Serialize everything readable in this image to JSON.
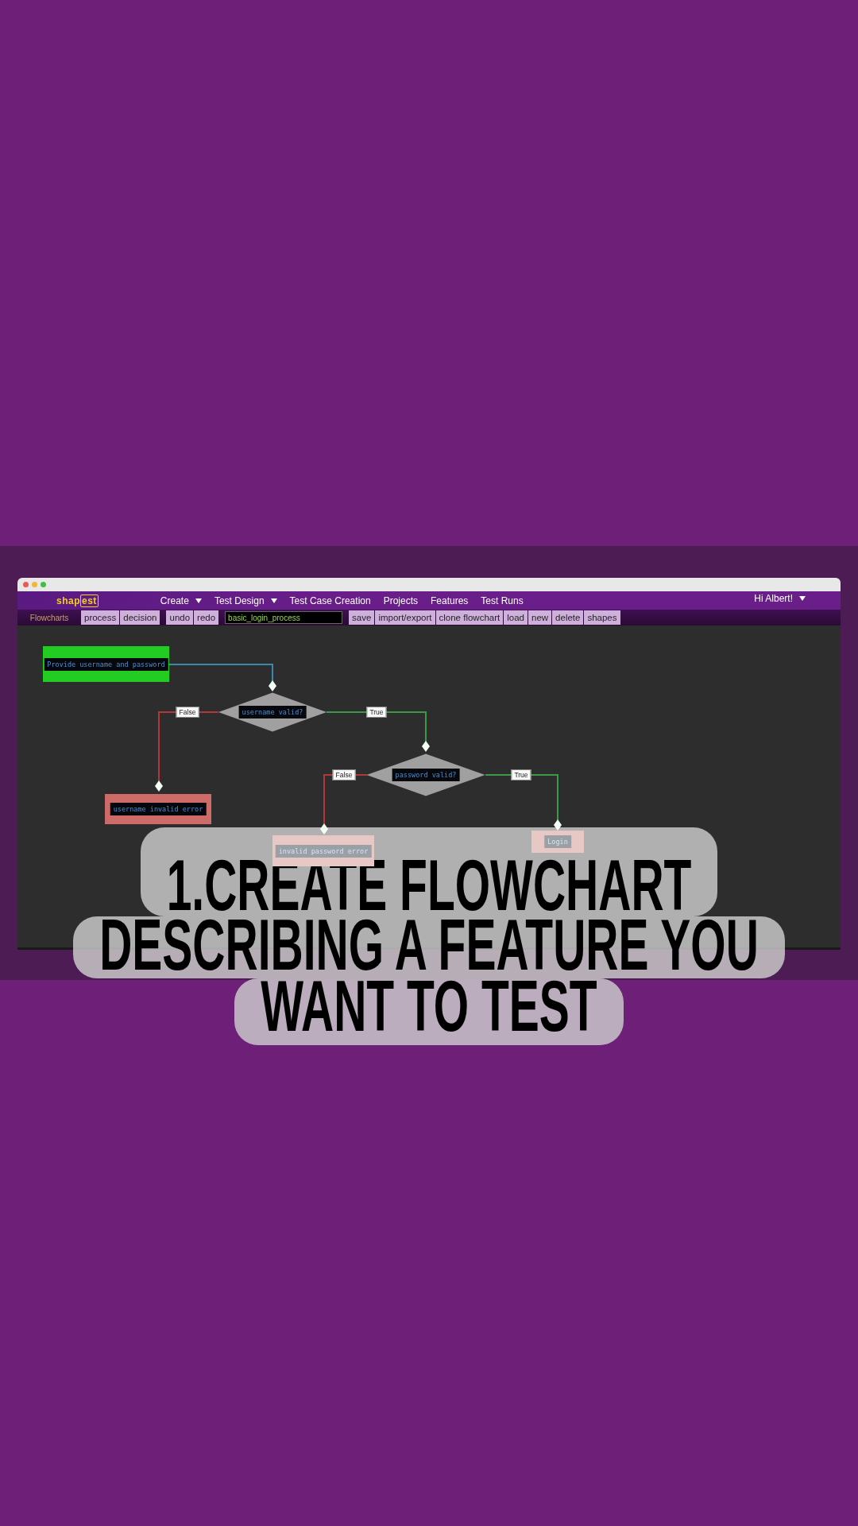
{
  "logo": {
    "text": "shap",
    "boxed": "est"
  },
  "menu": [
    {
      "label": "Create",
      "has_dropdown": true
    },
    {
      "label": "Test Design",
      "has_dropdown": true
    },
    {
      "label": "Test Case Creation",
      "has_dropdown": false
    },
    {
      "label": "Projects",
      "has_dropdown": false
    },
    {
      "label": "Features",
      "has_dropdown": false
    },
    {
      "label": "Test Runs",
      "has_dropdown": false
    }
  ],
  "user_menu": {
    "label": "Hi Albert!",
    "has_dropdown": true
  },
  "toolbar": {
    "section": "Flowcharts",
    "button_groups": [
      [
        "process",
        "decision"
      ],
      [
        "undo",
        "redo"
      ]
    ],
    "name_field": {
      "value": "basic_login_process"
    },
    "actions": [
      "save",
      "import/export",
      "clone flowchart",
      "load",
      "new",
      "delete",
      "shapes"
    ]
  },
  "flowchart": {
    "nodes": [
      {
        "kind": "process",
        "label": "Provide username and password",
        "color": "#22cc22"
      },
      {
        "kind": "decision",
        "label": "username valid?",
        "color": "#a0a0a0"
      },
      {
        "kind": "process",
        "label": "username invalid error",
        "color": "#cc6b68"
      },
      {
        "kind": "decision",
        "label": "password valid?",
        "color": "#a0a0a0"
      },
      {
        "kind": "process",
        "label": "invalid password error",
        "color": "#e8c8c4"
      },
      {
        "kind": "process",
        "label": "Login",
        "color": "#e8c8c4"
      }
    ],
    "edges": [
      {
        "color": "#3a8ab0"
      },
      {
        "label": "False",
        "color": "#b03838"
      },
      {
        "label": "True",
        "color": "#3a9a48"
      },
      {
        "label": "False",
        "color": "#b03838"
      },
      {
        "label": "True",
        "color": "#3a9a48"
      }
    ]
  },
  "caption": [
    "1.CREATE FLOWCHART",
    "DESCRIBING A FEATURE YOU",
    "WANT TO TEST"
  ]
}
